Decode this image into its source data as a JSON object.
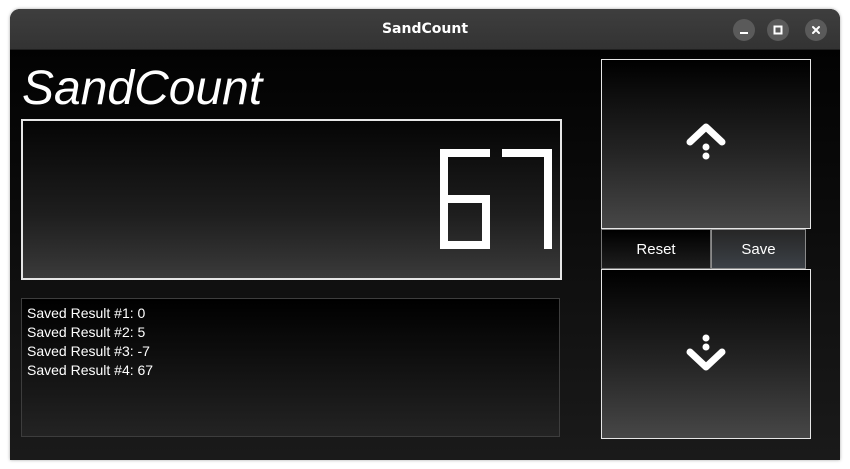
{
  "window": {
    "title": "SandCount",
    "controls": [
      "minimize-icon",
      "maximize-icon",
      "close-icon"
    ]
  },
  "app": {
    "heading": "SandCount",
    "count": "67"
  },
  "results": [
    "Saved Result #1: 0",
    "Saved Result #2: 5",
    "Saved Result #3: -7",
    "Saved Result #4: 67"
  ],
  "buttons": {
    "increment_icon": "chevron-up-icon",
    "decrement_icon": "chevron-down-icon",
    "reset_label": "Reset",
    "save_label": "Save"
  },
  "colors": {
    "background": "#000000",
    "border": "#e6e6e6",
    "text": "#ffffff",
    "titlebar": "#3a3a3a"
  }
}
